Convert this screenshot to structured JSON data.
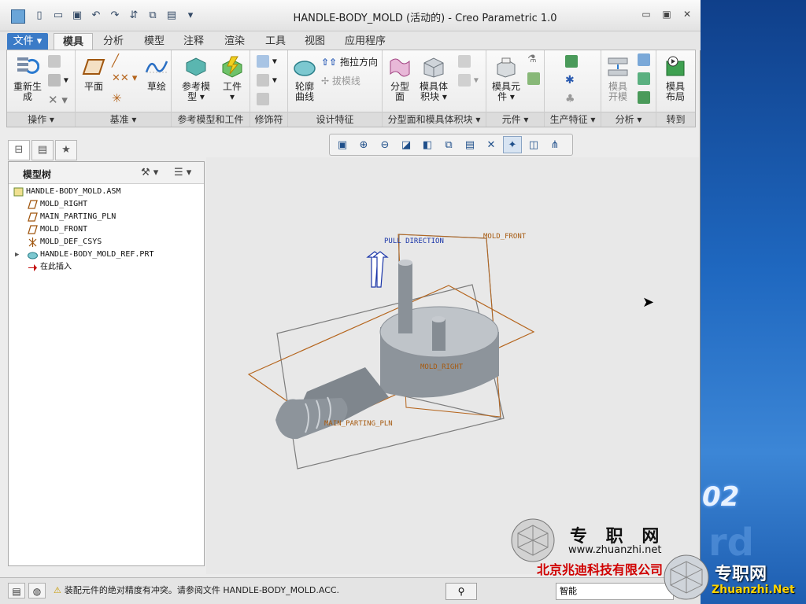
{
  "window": {
    "title": "HANDLE-BODY_MOLD (活动的) - Creo Parametric 1.0"
  },
  "ribbon_tabs": [
    "文件",
    "模具",
    "分析",
    "模型",
    "注释",
    "渲染",
    "工具",
    "视图",
    "应用程序"
  ],
  "ribbon": {
    "ops": {
      "regen": "重新生\n成",
      "label": "操作"
    },
    "datum": {
      "plane": "平面",
      "sketch": "草绘",
      "label": "基准"
    },
    "refmodel": {
      "ref": "参考模\n型",
      "work": "工件",
      "label": "参考模型和工件"
    },
    "modifier": {
      "label": "修饰符"
    },
    "design": {
      "curve": "轮廓\n曲线",
      "pull": "拖拉方向",
      "draft": "拔模线",
      "label": "设计特征"
    },
    "parting": {
      "surface": "分型\n面",
      "volume": "模具体\n积块",
      "label": "分型面和模具体积块"
    },
    "component": {
      "mold": "模具元\n件",
      "label": "元件"
    },
    "production": {
      "label": "生产特征"
    },
    "analysis": {
      "open": "模具\n开模",
      "label": "分析"
    },
    "goto": {
      "layout": "模具\n布局",
      "label": "转到"
    }
  },
  "panel": {
    "title": "模型树"
  },
  "tree": [
    {
      "label": "HANDLE-BODY_MOLD.ASM",
      "icon": "assembly-icon",
      "indent": 0,
      "expand": false
    },
    {
      "label": "MOLD_RIGHT",
      "icon": "datum-plane-icon",
      "indent": 1,
      "expand": false
    },
    {
      "label": "MAIN_PARTING_PLN",
      "icon": "datum-plane-icon",
      "indent": 1,
      "expand": false
    },
    {
      "label": "MOLD_FRONT",
      "icon": "datum-plane-icon",
      "indent": 1,
      "expand": false
    },
    {
      "label": "MOLD_DEF_CSYS",
      "icon": "csys-icon",
      "indent": 1,
      "expand": false
    },
    {
      "label": "HANDLE-BODY_MOLD_REF.PRT",
      "icon": "part-icon",
      "indent": 1,
      "expand": true
    },
    {
      "label": "在此插入",
      "icon": "insert-here-icon",
      "indent": 1,
      "expand": false
    }
  ],
  "viewport": {
    "pull": "PULL DIRECTION",
    "front": "MOLD_FRONT",
    "right": "MOLD_RIGHT",
    "parting": "MAIN_PARTING_PLN"
  },
  "status": {
    "message": "装配元件的绝对精度有冲突。请参阅文件 HANDLE-BODY_MOLD.ACC.",
    "filter": "智能"
  },
  "watermark": {
    "brand": "专 职 网",
    "url": "www.zhuanzhi.net",
    "company": "北京兆迪科技有限公司",
    "brand2": "专职网",
    "url2": "Zhuanzhi.Net",
    "number": "02"
  },
  "colors": {
    "accent": "#3b7bc7",
    "plane": "#b5651d",
    "pull": "#1a35a8"
  }
}
